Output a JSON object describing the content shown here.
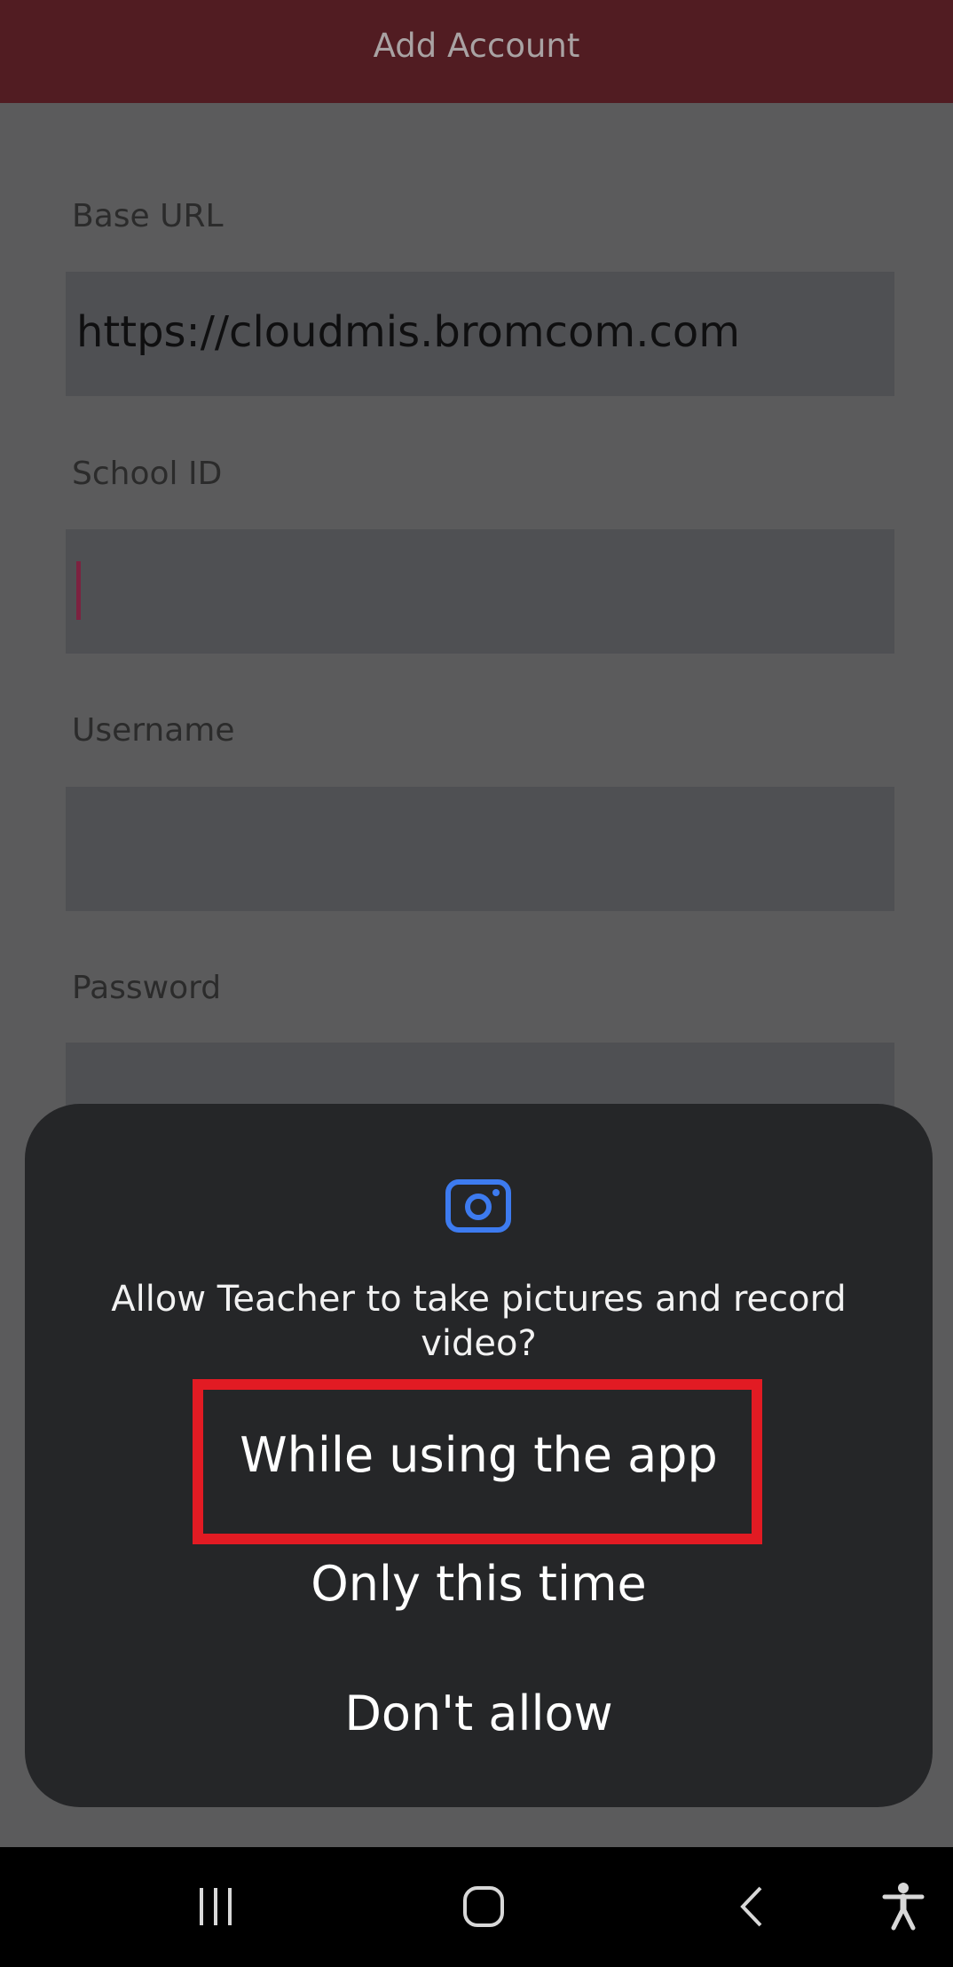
{
  "app_bar": {
    "title": "Add Account"
  },
  "form": {
    "base_url": {
      "label": "Base URL",
      "value": "https://cloudmis.bromcom.com"
    },
    "school_id": {
      "label": "School ID",
      "value": ""
    },
    "username": {
      "label": "Username",
      "value": ""
    },
    "password": {
      "label": "Password",
      "value": ""
    }
  },
  "dialog": {
    "icon": "camera-icon",
    "message": "Allow Teacher to take pictures and record video?",
    "options": [
      {
        "label": "While using the app"
      },
      {
        "label": "Only this time"
      },
      {
        "label": "Don't allow"
      }
    ]
  },
  "nav_bar": {
    "icons": [
      "recent-apps-icon",
      "home-icon",
      "back-icon",
      "accessibility-icon"
    ]
  },
  "colors": {
    "app_bar": "#511c22",
    "dialog_background": "#252628",
    "icon_accent": "#3d7bf0",
    "highlight": "#e21b23"
  }
}
